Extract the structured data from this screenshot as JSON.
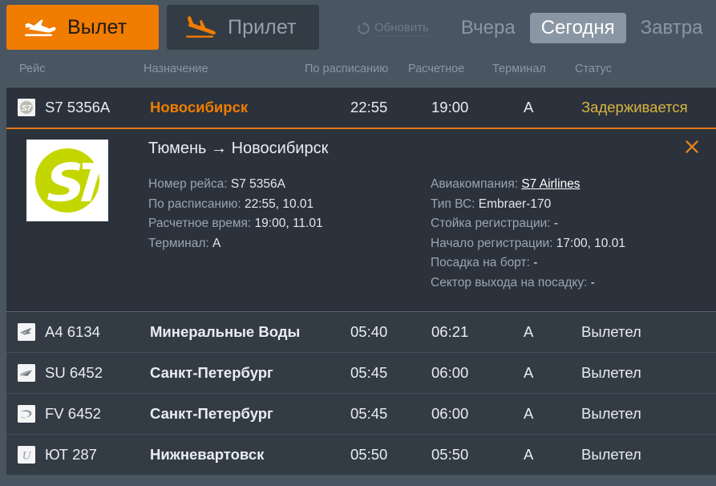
{
  "tabs": [
    {
      "label": "Вылет",
      "icon": "plane-departure-icon",
      "active": true
    },
    {
      "label": "Прилет",
      "icon": "plane-arrival-icon",
      "active": false
    }
  ],
  "refresh": {
    "label": "Обновить",
    "icon": "refresh-icon"
  },
  "days": [
    {
      "label": "Вчера",
      "active": false
    },
    {
      "label": "Сегодня",
      "active": true
    },
    {
      "label": "Завтра",
      "active": false
    }
  ],
  "columns": {
    "flight": "Рейс",
    "destination": "Назначение",
    "scheduled": "По расписанию",
    "estimated": "Расчетное",
    "terminal": "Терминал",
    "status": "Статус"
  },
  "rows": [
    {
      "logo": "s7-logo-icon",
      "number": "S7 5356A",
      "destination": "Новосибирск",
      "scheduled": "22:55",
      "estimated": "19:00",
      "terminal": "A",
      "status": "Задерживается",
      "selected": true
    },
    {
      "logo": "azimuth-logo-icon",
      "number": "A4 6134",
      "destination": "Минеральные Воды",
      "scheduled": "05:40",
      "estimated": "06:21",
      "terminal": "A",
      "status": "Вылетел",
      "selected": false
    },
    {
      "logo": "aeroflot-logo-icon",
      "number": "SU 6452",
      "destination": "Санкт-Петербург",
      "scheduled": "05:45",
      "estimated": "06:00",
      "terminal": "A",
      "status": "Вылетел",
      "selected": false
    },
    {
      "logo": "rossiya-logo-icon",
      "number": "FV 6452",
      "destination": "Санкт-Петербург",
      "scheduled": "05:45",
      "estimated": "06:00",
      "terminal": "A",
      "status": "Вылетел",
      "selected": false
    },
    {
      "logo": "utair-logo-icon",
      "number": "ЮТ 287",
      "destination": "Нижневартовск",
      "scheduled": "05:50",
      "estimated": "05:50",
      "terminal": "A",
      "status": "Вылетел",
      "selected": false
    }
  ],
  "detail": {
    "logo": "s7-logo-large-icon",
    "title": "Тюмень → Новосибирск",
    "close_icon": "close-icon",
    "left": [
      {
        "label": "Номер рейса:",
        "value": "S7 5356A"
      },
      {
        "label": "По расписанию:",
        "value": "22:55, 10.01"
      },
      {
        "label": "Расчетное время:",
        "value": "19:00, 11.01"
      },
      {
        "label": "Терминал:",
        "value": "A"
      }
    ],
    "right": [
      {
        "label": "Авиакомпания:",
        "value": "S7 Airlines",
        "link": true
      },
      {
        "label": "Тип ВС:",
        "value": "Embraer-170"
      },
      {
        "label": "Стойка регистрации:",
        "value": "-"
      },
      {
        "label": "Начало регистрации:",
        "value": "17:00, 10.01"
      },
      {
        "label": "Посадка на борт:",
        "value": "-"
      },
      {
        "label": "Сектор выхода на посадку:",
        "value": "-"
      }
    ]
  },
  "colors": {
    "accent_orange": "#f07c00",
    "page_bg": "#4a5562",
    "row_bg": "#333b45",
    "row_selected_bg": "#2b323b",
    "status_delayed": "#d9b441",
    "s7_green": "#c4d600"
  }
}
